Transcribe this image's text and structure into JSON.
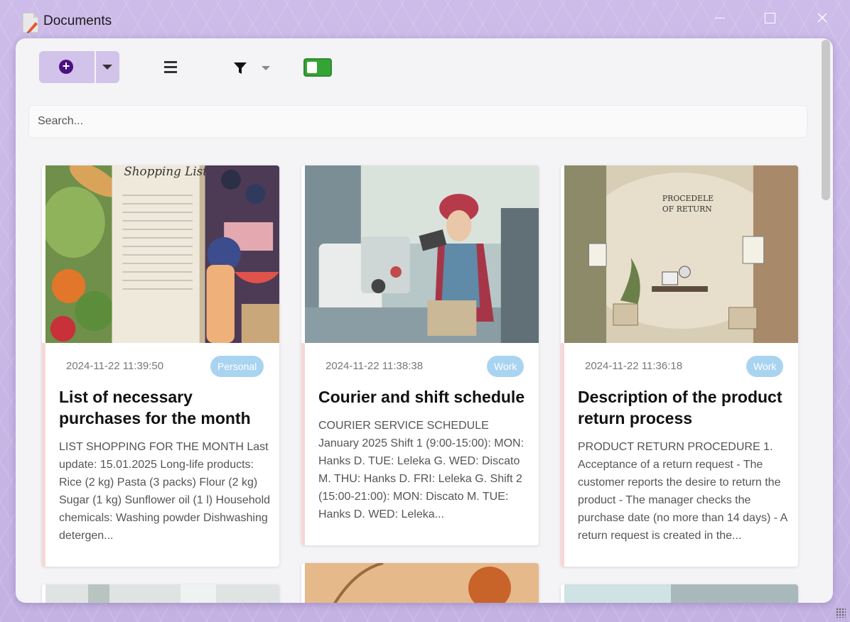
{
  "window": {
    "title": "Documents"
  },
  "toolbar": {
    "add_icon": "plus-circle-icon",
    "menu_icon": "hamburger-icon",
    "filter_icon": "funnel-icon",
    "toggle_state": "on"
  },
  "search": {
    "placeholder": "Search...",
    "value": ""
  },
  "cards": [
    {
      "date": "2024-11-22 11:39:50",
      "tag": "Personal",
      "title": "List of necessary purchases for the month",
      "excerpt": "LIST SHOPPING FOR THE MONTH Last update: 15.01.2025 Long-life products: Rice (2 kg) Pasta (3 packs) Flour (2 kg) Sugar (1 kg) Sunflower oil (1 l) Household chemicals: Washing powder Dishwashing detergen...",
      "image_heading": "Shopping List"
    },
    {
      "date": "2024-11-22 11:38:38",
      "tag": "Work",
      "title": "Courier and shift schedule",
      "excerpt": "COURIER SERVICE SCHEDULE January 2025 Shift 1 (9:00-15:00): MON: Hanks D. TUE: Leleka G. WED: Discato M. THU: Hanks D. FRI: Leleka G. Shift 2 (15:00-21:00): MON: Discato M. TUE: Hanks D. WED: Leleka..."
    },
    {
      "date": "2024-11-22 11:36:18",
      "tag": "Work",
      "title": "Description of the product return process",
      "excerpt": "PRODUCT RETURN PROCEDURE 1. Acceptance of a return request - The customer reports the desire to return the product - The manager checks the purchase date (no more than 14 days) - A return request is created in the...",
      "image_heading_1": "PROCEDELE",
      "image_heading_2": "OF RETURN"
    }
  ],
  "colors": {
    "accent": "#d2c3ea",
    "accent_dark": "#4a1180",
    "tag": "#a9d4f1",
    "toggle": "#36a336",
    "stripe": "#f7d7d7"
  }
}
